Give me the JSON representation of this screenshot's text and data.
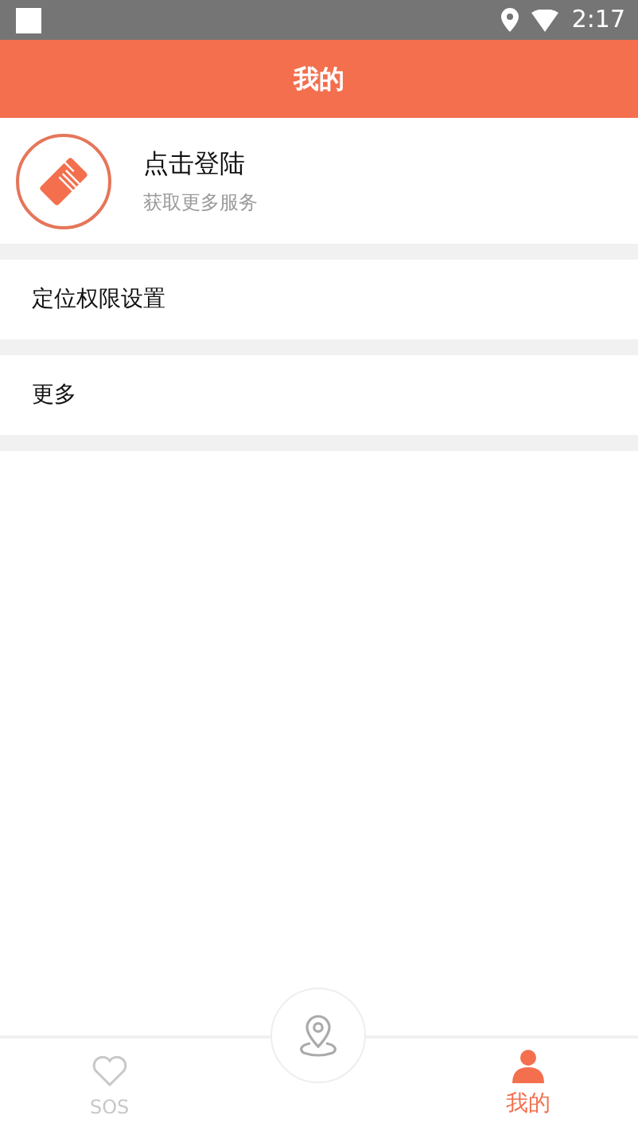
{
  "status_bar": {
    "time": "2:17"
  },
  "header": {
    "title": "我的"
  },
  "profile": {
    "title": "点击登陆",
    "subtitle": "获取更多服务"
  },
  "menu_items": [
    {
      "label": "定位权限设置"
    },
    {
      "label": "更多"
    }
  ],
  "tab_bar": [
    {
      "kind": "sos",
      "label": "SOS",
      "selected": false
    },
    {
      "kind": "location",
      "selected": false
    },
    {
      "kind": "me",
      "label": "我的",
      "selected": true
    }
  ]
}
